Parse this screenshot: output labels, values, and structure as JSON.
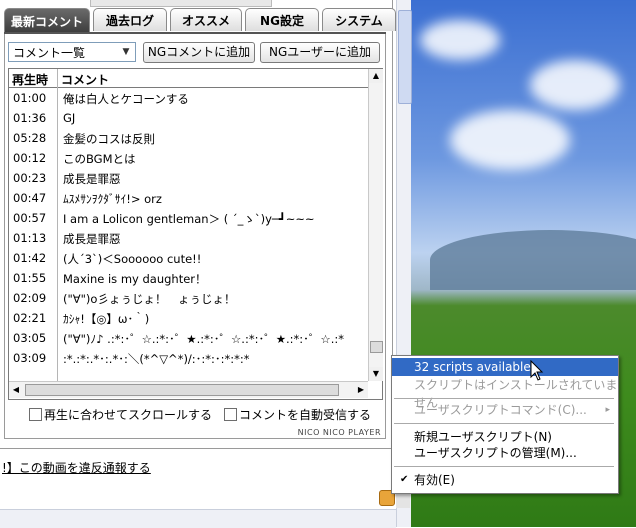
{
  "tabs": [
    {
      "label": "最新コメント",
      "active": true
    },
    {
      "label": "過去ログ",
      "active": false
    },
    {
      "label": "オススメ",
      "active": false
    },
    {
      "label": "NG設定",
      "active": false
    },
    {
      "label": "システム",
      "active": false
    }
  ],
  "toolbar": {
    "list_select": "コメント一覧",
    "ng_comment_button": "NGコメントに追加",
    "ng_user_button": "NGユーザーに追加"
  },
  "table": {
    "headers": {
      "time": "再生時",
      "comment": "コメント"
    },
    "rows": [
      {
        "time": "01:00",
        "comment": "俺は白人とケコーンする"
      },
      {
        "time": "01:36",
        "comment": "GJ"
      },
      {
        "time": "05:28",
        "comment": "金髪のコスは反則"
      },
      {
        "time": "00:12",
        "comment": "このBGMとは"
      },
      {
        "time": "00:23",
        "comment": "成長是罪惡"
      },
      {
        "time": "00:47",
        "comment": "ﾑｽﾒｻﾝｦｸﾀﾞｻｲ!> orz"
      },
      {
        "time": "00:57",
        "comment": "I am a Lolicon gentleman＞ ( ´_ゝ`)y─┛~~~"
      },
      {
        "time": "01:13",
        "comment": "成長是罪惡"
      },
      {
        "time": "01:42",
        "comment": "(人´3`)＜Soooooo cute!!"
      },
      {
        "time": "01:55",
        "comment": "Maxine is my daughter！"
      },
      {
        "time": "02:09",
        "comment": "(\"∀\")o彡ょぅじょ！　ょぅじょ！"
      },
      {
        "time": "02:21",
        "comment": "ｶｼｬ!【◎】ω･｀)"
      },
      {
        "time": "03:05",
        "comment": "(\"∀\")ﾉ♪ .:*:･゜☆.:*:･゜★.:*:･゜☆.:*:･゜★.:*:･゜☆.:*"
      },
      {
        "time": "03:09",
        "comment": ":*.:*:.*･:.*･:＼(*^▽^*)/:･:*:･:*:*:*"
      }
    ]
  },
  "options": {
    "scroll_sync": "再生に合わせてスクロールする",
    "auto_receive": "コメントを自動受信する"
  },
  "brand": "NICO NICO PLAYER",
  "report_link": "!】この動画を違反通報する",
  "context_menu": {
    "items": [
      {
        "label": "32 scripts available",
        "state": "selected"
      },
      {
        "label": "スクリプトはインストールされていません",
        "state": "disabled"
      },
      {
        "label": "ユーザスクリプトコマンド(C)...",
        "state": "disabled",
        "submenu": "▸"
      },
      {
        "label": "新規ユーザスクリプト(N)",
        "state": "enabled"
      },
      {
        "label": "ユーザスクリプトの管理(M)...",
        "state": "enabled"
      },
      {
        "label": "有効(E)",
        "state": "checked",
        "check": "✔"
      }
    ]
  },
  "colors": {
    "menu_highlight": "#316ac5",
    "tab_active": "#4a4a4a"
  }
}
